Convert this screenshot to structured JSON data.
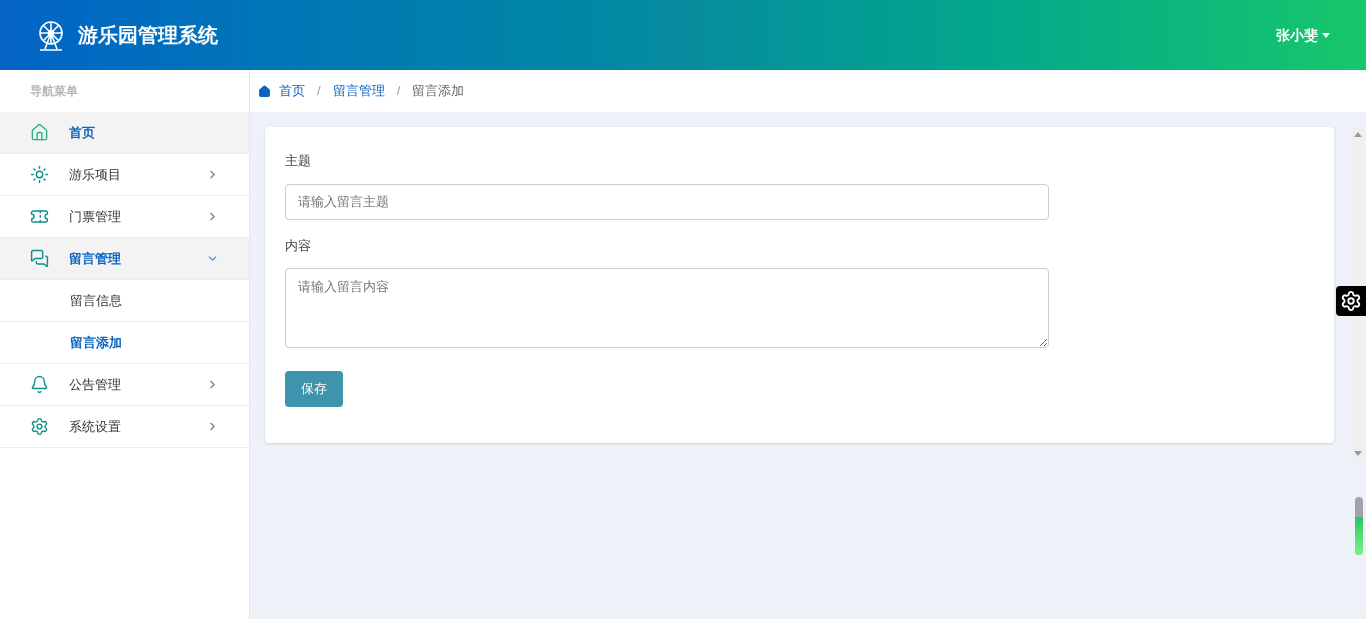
{
  "header": {
    "title": "游乐园管理系统",
    "user": "张小斐"
  },
  "sidebar": {
    "heading": "导航菜单",
    "items": [
      {
        "label": "首页",
        "selected": true
      },
      {
        "label": "游乐项目",
        "selected": false,
        "expanded": false
      },
      {
        "label": "门票管理",
        "selected": false,
        "expanded": false
      },
      {
        "label": "留言管理",
        "selected": true,
        "expanded": true,
        "children": [
          {
            "label": "留言信息",
            "selected": false
          },
          {
            "label": "留言添加",
            "selected": true
          }
        ]
      },
      {
        "label": "公告管理",
        "selected": false,
        "expanded": false
      },
      {
        "label": "系统设置",
        "selected": false,
        "expanded": false
      }
    ]
  },
  "breadcrumb": [
    {
      "label": "首页",
      "link": true
    },
    {
      "separator": "/"
    },
    {
      "label": "留言管理",
      "link": true
    },
    {
      "separator": "/"
    },
    {
      "label": "留言添加",
      "link": false
    }
  ],
  "form": {
    "fields": [
      {
        "label": "主题",
        "kind": "input",
        "placeholder": "请输入留言主题"
      },
      {
        "label": "内容",
        "kind": "textarea",
        "placeholder": "请输入留言内容"
      }
    ],
    "submit": "保存"
  }
}
